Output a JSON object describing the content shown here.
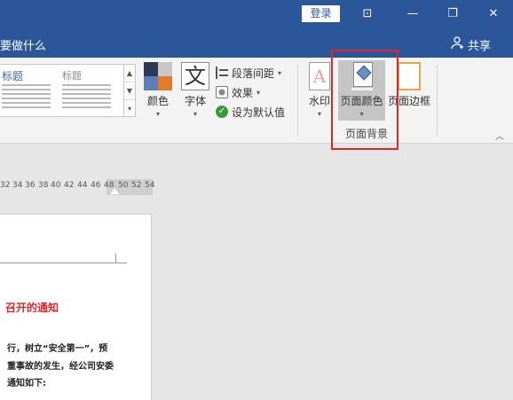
{
  "titlebar": {
    "login_label": "登录",
    "controls": [
      "restore-ribbon",
      "minimize",
      "restore",
      "close"
    ]
  },
  "tabbar": {
    "tell_me": "要做什么",
    "share_label": "共享"
  },
  "ribbon": {
    "styles_gallery": {
      "style1_title": "标题",
      "style2_title": "标题"
    },
    "colors_label": "颜色",
    "fonts_label": "字体",
    "font_icon_glyph": "文",
    "paragraph_spacing_label": "段落间距",
    "effects_label": "效果",
    "set_default_label": "设为默认值",
    "watermark_label": "水印",
    "watermark_glyph": "A",
    "page_color_label": "页面颜色",
    "page_border_label": "页面边框",
    "page_background_group": "页面背景",
    "theme_colors": [
      "#2b3b55",
      "#c8c8c8",
      "#5b7fb8",
      "#e07a2e"
    ]
  },
  "ruler": {
    "ticks": [
      "32",
      "34",
      "36",
      "38",
      "40",
      "42",
      "44",
      "46",
      "48",
      "50",
      "52",
      "54"
    ]
  },
  "document": {
    "heading": "召开的通知",
    "lines": [
      "行，树立“安全第一”，预",
      "重事故的发生，经公司安委",
      "通知如下:"
    ]
  },
  "colors": {
    "title_bar": "#2b579a",
    "highlight_box": "#e0262b",
    "heading_red": "#e0262b"
  }
}
